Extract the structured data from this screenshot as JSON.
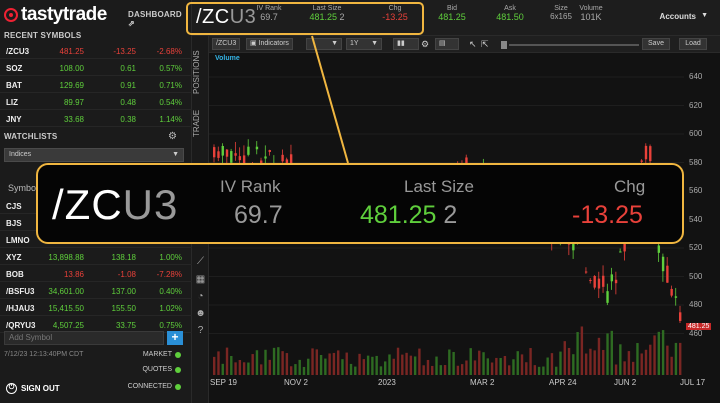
{
  "brand": {
    "name": "tastytrade",
    "dashboard": "DASHBOARD"
  },
  "colors": {
    "positive": "#5fcf3c",
    "negative": "#e8413a",
    "accent": "#f0b640",
    "link": "#34b3e4"
  },
  "recent_symbols": {
    "title": "RECENT SYMBOLS",
    "rows": [
      {
        "sym": "/ZCU3",
        "price": "481.25",
        "chg": "-13.25",
        "pct": "-2.68%",
        "dir": "neg"
      },
      {
        "sym": "SOZ",
        "price": "108.00",
        "chg": "0.61",
        "pct": "0.57%",
        "dir": "pos"
      },
      {
        "sym": "BAT",
        "price": "129.69",
        "chg": "0.91",
        "pct": "0.71%",
        "dir": "pos"
      },
      {
        "sym": "LIZ",
        "price": "89.97",
        "chg": "0.48",
        "pct": "0.54%",
        "dir": "pos"
      },
      {
        "sym": "JNY",
        "price": "33.68",
        "chg": "0.38",
        "pct": "1.14%",
        "dir": "pos"
      }
    ]
  },
  "watchlists": {
    "title": "WATCHLISTS",
    "selected": "Indices",
    "column_label": "Symbo",
    "rows": [
      {
        "sym": "CJS",
        "price": "",
        "chg": "",
        "pct": "",
        "dir": "pos"
      },
      {
        "sym": "BJS",
        "price": "",
        "chg": "",
        "pct": "",
        "dir": "pos"
      },
      {
        "sym": "LMNO",
        "price": "",
        "chg": "",
        "pct": "",
        "dir": "pos"
      },
      {
        "sym": "XYZ",
        "price": "13,898.88",
        "chg": "138.18",
        "pct": "1.00%",
        "dir": "pos"
      },
      {
        "sym": "BOB",
        "price": "13.86",
        "chg": "-1.08",
        "pct": "-7.28%",
        "dir": "neg"
      },
      {
        "sym": "/BSFU3",
        "price": "34,601.00",
        "chg": "137.00",
        "pct": "0.40%",
        "dir": "pos"
      },
      {
        "sym": "/HJAU3",
        "price": "15,415.50",
        "chg": "155.50",
        "pct": "1.02%",
        "dir": "pos"
      },
      {
        "sym": "/QRYU3",
        "price": "4,507.25",
        "chg": "33.75",
        "pct": "0.75%",
        "dir": "pos"
      }
    ]
  },
  "search": {
    "placeholder": "Add Symbol"
  },
  "timestamp": "7/12/23 12:13:40PM CDT",
  "status": [
    {
      "label": "MARKET"
    },
    {
      "label": "QUOTES"
    },
    {
      "label": "CONNECTED"
    }
  ],
  "signout": "SIGN OUT",
  "side_tabs": [
    "POSITIONS",
    "TRADE"
  ],
  "header": {
    "sym_main": "/ZC",
    "sym_dim": "U3",
    "iv_rank_label": "IV Rank",
    "iv_rank": "69.7",
    "last_size_label": "Last Size",
    "last": "481.25",
    "size": "2",
    "chg_label": "Chg",
    "chg": "-13.25",
    "bid_label": "Bid",
    "bid": "481.25",
    "ask_label": "Ask",
    "ask": "481.50",
    "sz_label": "Size",
    "sz": "6x165",
    "vol_label": "Volume",
    "vol": "101K",
    "accounts": "Accounts"
  },
  "toolbar": {
    "symbol": "/ZCU3",
    "indicators": "Indicators",
    "period": "1Y",
    "save": "Save",
    "load": "Load"
  },
  "chart_data": {
    "type": "candlestick",
    "volume_label": "Volume",
    "y_ticks": [
      "640",
      "620",
      "600",
      "580",
      "560",
      "540",
      "520",
      "500",
      "480",
      "460"
    ],
    "x_ticks": [
      "SEP 19",
      "NOV 2",
      "2023",
      "MAR 2",
      "APR 24",
      "JUN 2",
      "JUL 17"
    ],
    "last_price": "481.25",
    "ylim": [
      450,
      650
    ]
  }
}
